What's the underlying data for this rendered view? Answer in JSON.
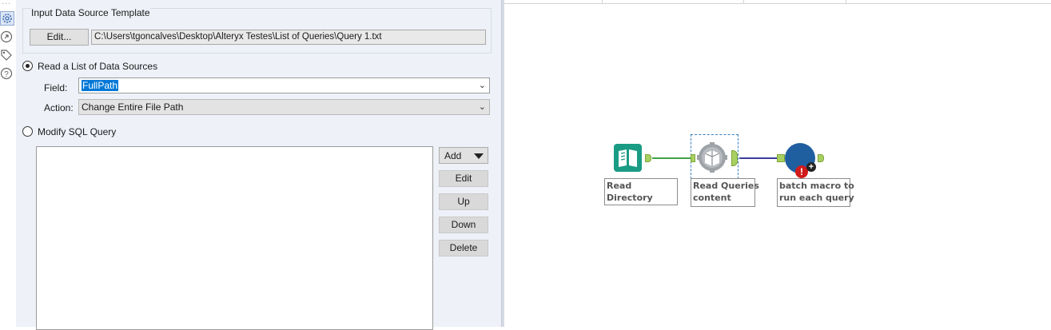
{
  "icon_strip": {
    "dots": "...",
    "icons": [
      "gear-icon",
      "annotation-icon",
      "tag-icon",
      "help-icon"
    ]
  },
  "config": {
    "group_title": "Input Data Source Template",
    "edit_button": "Edit...",
    "template_path": "C:\\Users\\tgoncalves\\Desktop\\Alteryx Testes\\List of Queries\\Query 1.txt",
    "radio_read_list": "Read a List of Data Sources",
    "field_label": "Field:",
    "field_value": "FullPath",
    "action_label": "Action:",
    "action_value": "Change Entire File Path",
    "radio_modify_sql": "Modify SQL Query",
    "add_button": "Add",
    "edit_list_button": "Edit",
    "up_button": "Up",
    "down_button": "Down",
    "delete_button": "Delete"
  },
  "workflow": {
    "tools": [
      {
        "name": "read-directory",
        "label": "Read Directory",
        "color": "#1a9b84"
      },
      {
        "name": "read-queries-content",
        "label": "Read Queries\ncontent",
        "color": "#9ea3a8"
      },
      {
        "name": "batch-macro",
        "label": "batch macro to\nrun each query",
        "color": "#1f5fa0"
      }
    ],
    "connection_colors": {
      "first": "#3fa048",
      "second": "#3a3f9c"
    },
    "error_badge": "!",
    "add_badge": "+"
  }
}
